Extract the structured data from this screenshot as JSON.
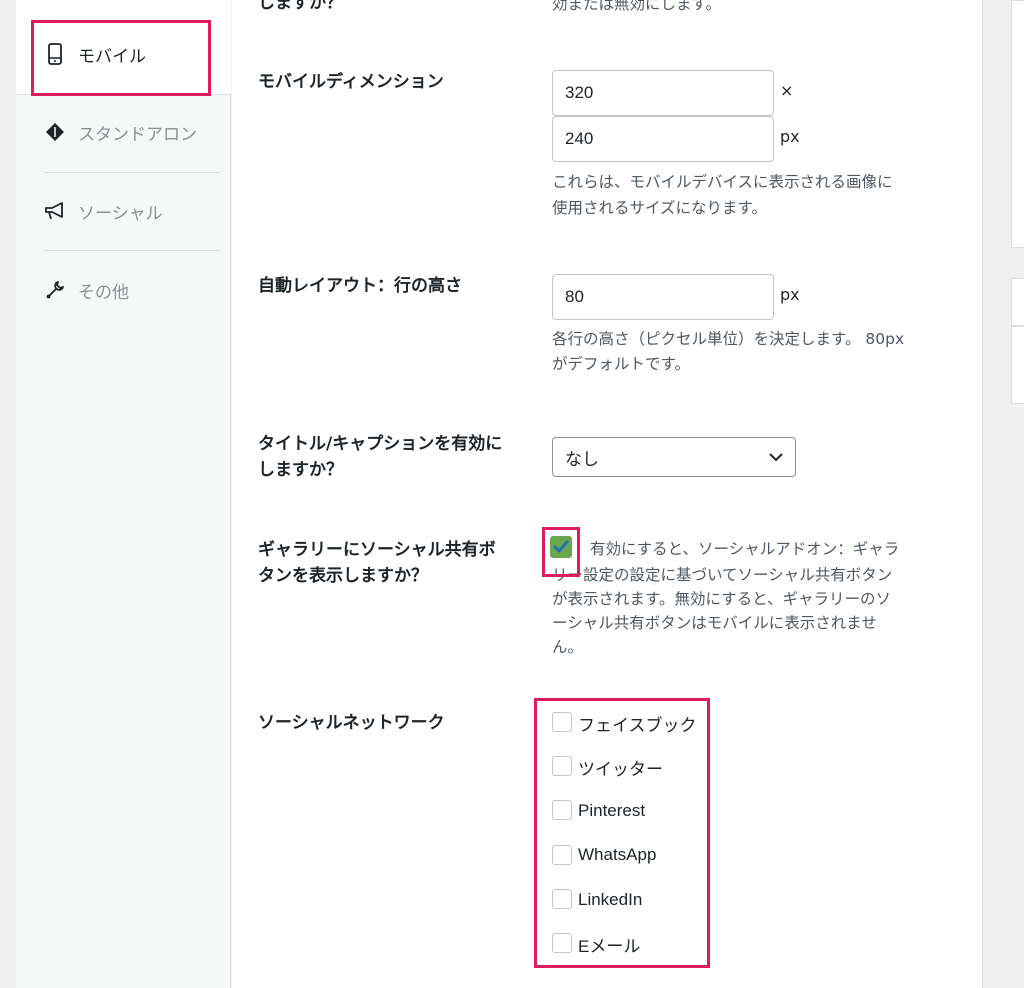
{
  "sidebar": {
    "items": [
      {
        "label": "モバイル",
        "icon": "mobile-icon",
        "active": true
      },
      {
        "label": "スタンドアロン",
        "icon": "diamond-icon",
        "active": false
      },
      {
        "label": "ソーシャル",
        "icon": "megaphone-icon",
        "active": false
      },
      {
        "label": "その他",
        "icon": "wrench-icon",
        "active": false
      }
    ]
  },
  "top_partial": {
    "label": "しますか？",
    "desc": "効または無効にします。"
  },
  "mobile_dimensions": {
    "label": "モバイルディメンション",
    "width": "320",
    "height": "240",
    "times": "×",
    "unit": "px",
    "desc_line1": "これらは、モバイルデバイスに表示される画像に",
    "desc_line2": "使用されるサイズになります。"
  },
  "auto_layout": {
    "label": "自動レイアウト：行の高さ",
    "value": "80",
    "unit": "px",
    "desc_line1": "各行の高さ（ピクセル単位）を決定します。 80px",
    "desc_line2": "がデフォルトです。"
  },
  "title_caption": {
    "label_line1": "タイトル/キャプションを有効に",
    "label_line2": "しますか？",
    "selected": "なし"
  },
  "social_buttons": {
    "label_line1": "ギャラリーにソーシャル共有ボ",
    "label_line2": "タンを表示しますか？",
    "checked": true,
    "desc_line1": "有効にすると、ソーシャルアドオン：ギャラ",
    "desc_line2": "リー設定の設定に基づいてソーシャル共有ボタン",
    "desc_line3": "が表示されます。無効にすると、ギャラリーのソ",
    "desc_line4": "ーシャル共有ボタンはモバイルに表示されませ",
    "desc_line5": "ん。"
  },
  "social_networks": {
    "label": "ソーシャルネットワーク",
    "options": [
      "フェイスブック",
      "ツイッター",
      "Pinterest",
      "WhatsApp",
      "LinkedIn",
      "Eメール"
    ]
  },
  "colors": {
    "highlight": "#e01b5b",
    "checkbox_checked": "#6aa84f",
    "check_mark": "#2271b1"
  }
}
